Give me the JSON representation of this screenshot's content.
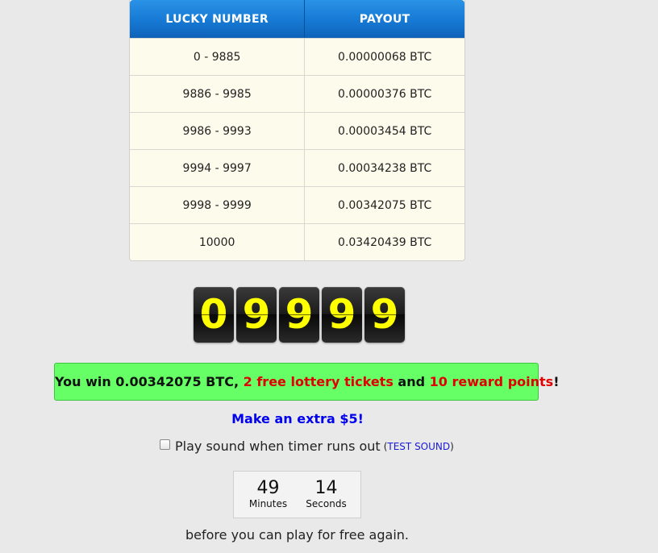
{
  "payout_table": {
    "headers": [
      "LUCKY NUMBER",
      "PAYOUT"
    ],
    "rows": [
      [
        "0 - 9885",
        "0.00000068 BTC"
      ],
      [
        "9886 - 9985",
        "0.00000376 BTC"
      ],
      [
        "9986 - 9993",
        "0.00003454 BTC"
      ],
      [
        "9994 - 9997",
        "0.00034238 BTC"
      ],
      [
        "9998 - 9999",
        "0.00342075 BTC"
      ],
      [
        "10000",
        "0.03420439 BTC"
      ]
    ]
  },
  "lucky_number": {
    "digits": [
      "0",
      "9",
      "9",
      "9",
      "9"
    ],
    "digit_color": "#ffff00"
  },
  "result": {
    "prefix": "You win 0.00342075 BTC, ",
    "tickets": "2 free lottery tickets",
    "middle": " and ",
    "points": "10 reward points",
    "suffix": "!",
    "banner_color": "#66ff66",
    "highlight_color": "#e00000"
  },
  "extra_link": "Make an extra $5!",
  "sound_option": {
    "label": "Play sound when timer runs out",
    "checked": false,
    "test_open": "(",
    "test_label": "TEST SOUND",
    "test_close": ")"
  },
  "countdown": {
    "minutes": "49",
    "minutes_label": "Minutes",
    "seconds": "14",
    "seconds_label": "Seconds"
  },
  "footer_text": "before you can play for free again."
}
